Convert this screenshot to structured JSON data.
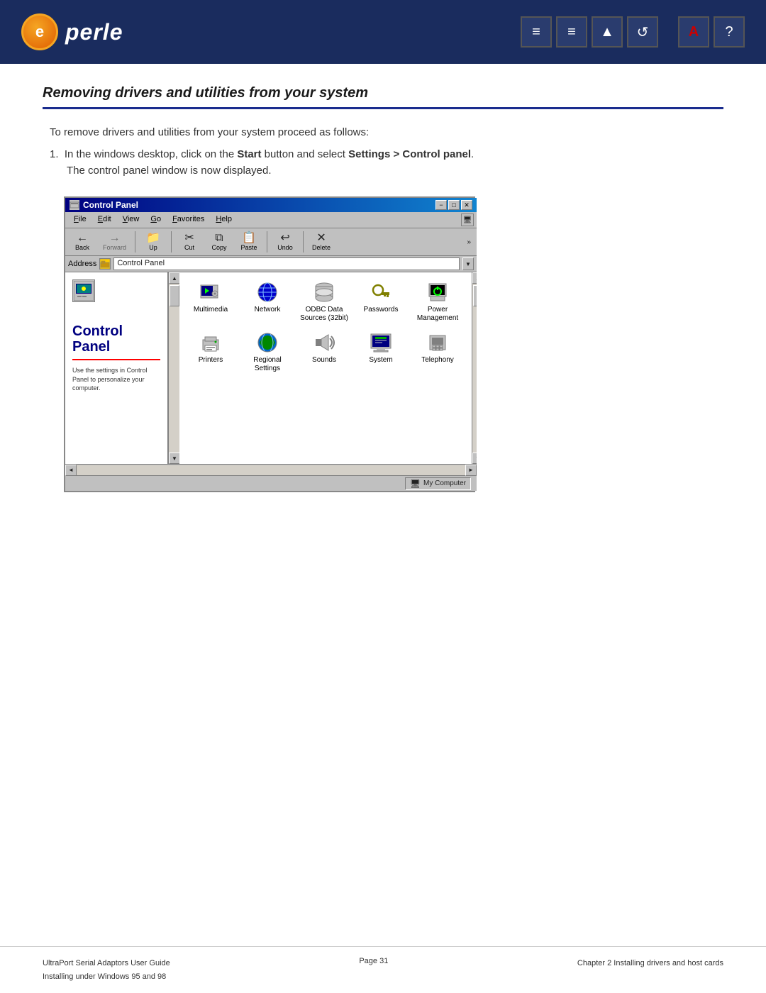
{
  "header": {
    "logo_text": "perle",
    "icons": [
      "≡",
      "≡",
      "▲",
      "↺",
      "A",
      "?"
    ]
  },
  "section": {
    "title": "Removing drivers and utilities from your system",
    "intro": "To remove drivers and utilities from your system proceed as follows:",
    "step1": {
      "text_prefix": "In the windows desktop, click on the ",
      "bold1": "Start",
      "text_mid1": " button and select ",
      "bold2": "Settings > Control panel",
      "text_end": ".",
      "sub": "The control panel window is now displayed."
    }
  },
  "win95": {
    "title": "Control Panel",
    "titlebar_buttons": [
      "-",
      "□",
      "✕"
    ],
    "menu_items": [
      "File",
      "Edit",
      "View",
      "Go",
      "Favorites",
      "Help"
    ],
    "toolbar_buttons": [
      {
        "label": "Back",
        "icon": "←"
      },
      {
        "label": "Forward",
        "icon": "→"
      },
      {
        "label": "Up",
        "icon": "↑"
      },
      {
        "label": "Cut",
        "icon": "✂"
      },
      {
        "label": "Copy",
        "icon": "⧉"
      },
      {
        "label": "Paste",
        "icon": "📋"
      },
      {
        "label": "Undo",
        "icon": "↩"
      },
      {
        "label": "Delete",
        "icon": "✕"
      }
    ],
    "address_label": "Address",
    "address_value": "Control Panel",
    "sidebar_title": "Control Panel",
    "sidebar_desc": "Use the settings in Control Panel to personalize your computer.",
    "icons": [
      {
        "label": "Multimedia",
        "icon": "🎵"
      },
      {
        "label": "Network",
        "icon": "🌐"
      },
      {
        "label": "ODBC Data Sources (32bit)",
        "icon": "🗄"
      },
      {
        "label": "Passwords",
        "icon": "🔑"
      },
      {
        "label": "Power Management",
        "icon": "⚡"
      },
      {
        "label": "Printers",
        "icon": "🖨"
      },
      {
        "label": "Regional Settings",
        "icon": "🌍"
      },
      {
        "label": "Sounds",
        "icon": "🔊"
      },
      {
        "label": "System",
        "icon": "💻"
      },
      {
        "label": "Telephony",
        "icon": "📞"
      }
    ],
    "statusbar_text": "My Computer",
    "scroll_up": "▲",
    "scroll_down": "▼",
    "scroll_left": "◄",
    "scroll_right": "►",
    "more": "»"
  },
  "footer": {
    "left_line1": "UltraPort Serial Adaptors User Guide",
    "left_line2": "Installing under Windows 95 and 98",
    "center": "Page 31",
    "right_line1": "Chapter 2 Installing drivers and host cards",
    "right_line2": ""
  }
}
